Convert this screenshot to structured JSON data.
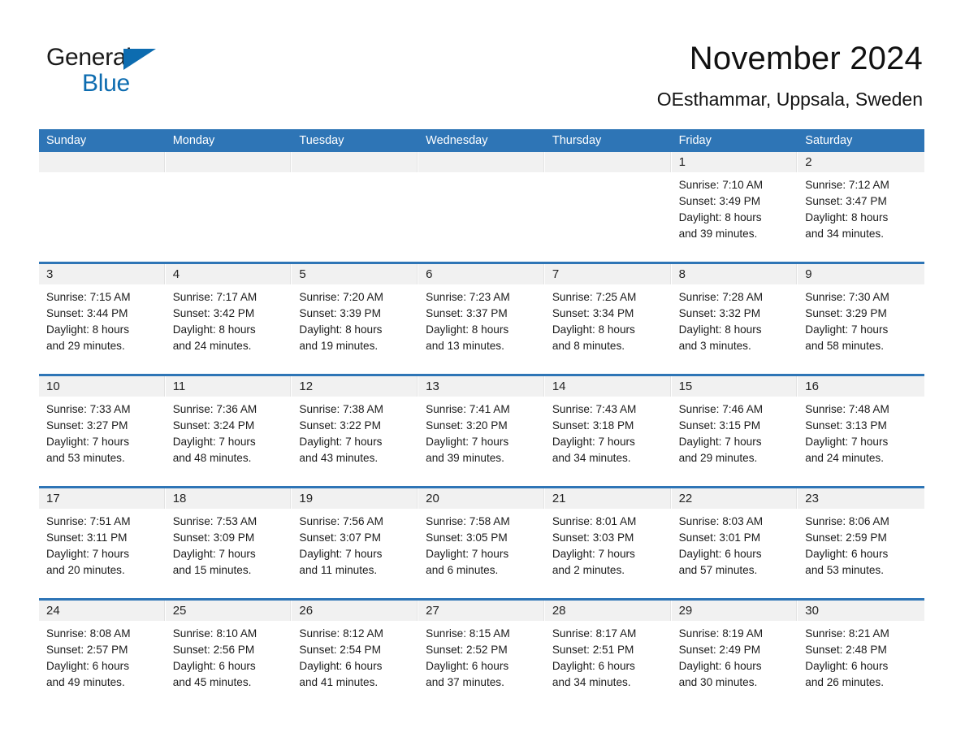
{
  "brand": {
    "line1": "General",
    "line2": "Blue",
    "accent_color": "#0d6cb0"
  },
  "header": {
    "title": "November 2024",
    "location": "OEsthammar, Uppsala, Sweden"
  },
  "theme": {
    "header_blue": "#2e75b6",
    "daynum_strip": "#f1f1f1",
    "text": "#1b1b1b"
  },
  "weekdays": [
    "Sunday",
    "Monday",
    "Tuesday",
    "Wednesday",
    "Thursday",
    "Friday",
    "Saturday"
  ],
  "weeks": [
    [
      {
        "day": "",
        "lines": []
      },
      {
        "day": "",
        "lines": []
      },
      {
        "day": "",
        "lines": []
      },
      {
        "day": "",
        "lines": []
      },
      {
        "day": "",
        "lines": []
      },
      {
        "day": "1",
        "lines": [
          "Sunrise: 7:10 AM",
          "Sunset: 3:49 PM",
          "Daylight: 8 hours",
          "and 39 minutes."
        ]
      },
      {
        "day": "2",
        "lines": [
          "Sunrise: 7:12 AM",
          "Sunset: 3:47 PM",
          "Daylight: 8 hours",
          "and 34 minutes."
        ]
      }
    ],
    [
      {
        "day": "3",
        "lines": [
          "Sunrise: 7:15 AM",
          "Sunset: 3:44 PM",
          "Daylight: 8 hours",
          "and 29 minutes."
        ]
      },
      {
        "day": "4",
        "lines": [
          "Sunrise: 7:17 AM",
          "Sunset: 3:42 PM",
          "Daylight: 8 hours",
          "and 24 minutes."
        ]
      },
      {
        "day": "5",
        "lines": [
          "Sunrise: 7:20 AM",
          "Sunset: 3:39 PM",
          "Daylight: 8 hours",
          "and 19 minutes."
        ]
      },
      {
        "day": "6",
        "lines": [
          "Sunrise: 7:23 AM",
          "Sunset: 3:37 PM",
          "Daylight: 8 hours",
          "and 13 minutes."
        ]
      },
      {
        "day": "7",
        "lines": [
          "Sunrise: 7:25 AM",
          "Sunset: 3:34 PM",
          "Daylight: 8 hours",
          "and 8 minutes."
        ]
      },
      {
        "day": "8",
        "lines": [
          "Sunrise: 7:28 AM",
          "Sunset: 3:32 PM",
          "Daylight: 8 hours",
          "and 3 minutes."
        ]
      },
      {
        "day": "9",
        "lines": [
          "Sunrise: 7:30 AM",
          "Sunset: 3:29 PM",
          "Daylight: 7 hours",
          "and 58 minutes."
        ]
      }
    ],
    [
      {
        "day": "10",
        "lines": [
          "Sunrise: 7:33 AM",
          "Sunset: 3:27 PM",
          "Daylight: 7 hours",
          "and 53 minutes."
        ]
      },
      {
        "day": "11",
        "lines": [
          "Sunrise: 7:36 AM",
          "Sunset: 3:24 PM",
          "Daylight: 7 hours",
          "and 48 minutes."
        ]
      },
      {
        "day": "12",
        "lines": [
          "Sunrise: 7:38 AM",
          "Sunset: 3:22 PM",
          "Daylight: 7 hours",
          "and 43 minutes."
        ]
      },
      {
        "day": "13",
        "lines": [
          "Sunrise: 7:41 AM",
          "Sunset: 3:20 PM",
          "Daylight: 7 hours",
          "and 39 minutes."
        ]
      },
      {
        "day": "14",
        "lines": [
          "Sunrise: 7:43 AM",
          "Sunset: 3:18 PM",
          "Daylight: 7 hours",
          "and 34 minutes."
        ]
      },
      {
        "day": "15",
        "lines": [
          "Sunrise: 7:46 AM",
          "Sunset: 3:15 PM",
          "Daylight: 7 hours",
          "and 29 minutes."
        ]
      },
      {
        "day": "16",
        "lines": [
          "Sunrise: 7:48 AM",
          "Sunset: 3:13 PM",
          "Daylight: 7 hours",
          "and 24 minutes."
        ]
      }
    ],
    [
      {
        "day": "17",
        "lines": [
          "Sunrise: 7:51 AM",
          "Sunset: 3:11 PM",
          "Daylight: 7 hours",
          "and 20 minutes."
        ]
      },
      {
        "day": "18",
        "lines": [
          "Sunrise: 7:53 AM",
          "Sunset: 3:09 PM",
          "Daylight: 7 hours",
          "and 15 minutes."
        ]
      },
      {
        "day": "19",
        "lines": [
          "Sunrise: 7:56 AM",
          "Sunset: 3:07 PM",
          "Daylight: 7 hours",
          "and 11 minutes."
        ]
      },
      {
        "day": "20",
        "lines": [
          "Sunrise: 7:58 AM",
          "Sunset: 3:05 PM",
          "Daylight: 7 hours",
          "and 6 minutes."
        ]
      },
      {
        "day": "21",
        "lines": [
          "Sunrise: 8:01 AM",
          "Sunset: 3:03 PM",
          "Daylight: 7 hours",
          "and 2 minutes."
        ]
      },
      {
        "day": "22",
        "lines": [
          "Sunrise: 8:03 AM",
          "Sunset: 3:01 PM",
          "Daylight: 6 hours",
          "and 57 minutes."
        ]
      },
      {
        "day": "23",
        "lines": [
          "Sunrise: 8:06 AM",
          "Sunset: 2:59 PM",
          "Daylight: 6 hours",
          "and 53 minutes."
        ]
      }
    ],
    [
      {
        "day": "24",
        "lines": [
          "Sunrise: 8:08 AM",
          "Sunset: 2:57 PM",
          "Daylight: 6 hours",
          "and 49 minutes."
        ]
      },
      {
        "day": "25",
        "lines": [
          "Sunrise: 8:10 AM",
          "Sunset: 2:56 PM",
          "Daylight: 6 hours",
          "and 45 minutes."
        ]
      },
      {
        "day": "26",
        "lines": [
          "Sunrise: 8:12 AM",
          "Sunset: 2:54 PM",
          "Daylight: 6 hours",
          "and 41 minutes."
        ]
      },
      {
        "day": "27",
        "lines": [
          "Sunrise: 8:15 AM",
          "Sunset: 2:52 PM",
          "Daylight: 6 hours",
          "and 37 minutes."
        ]
      },
      {
        "day": "28",
        "lines": [
          "Sunrise: 8:17 AM",
          "Sunset: 2:51 PM",
          "Daylight: 6 hours",
          "and 34 minutes."
        ]
      },
      {
        "day": "29",
        "lines": [
          "Sunrise: 8:19 AM",
          "Sunset: 2:49 PM",
          "Daylight: 6 hours",
          "and 30 minutes."
        ]
      },
      {
        "day": "30",
        "lines": [
          "Sunrise: 8:21 AM",
          "Sunset: 2:48 PM",
          "Daylight: 6 hours",
          "and 26 minutes."
        ]
      }
    ]
  ]
}
